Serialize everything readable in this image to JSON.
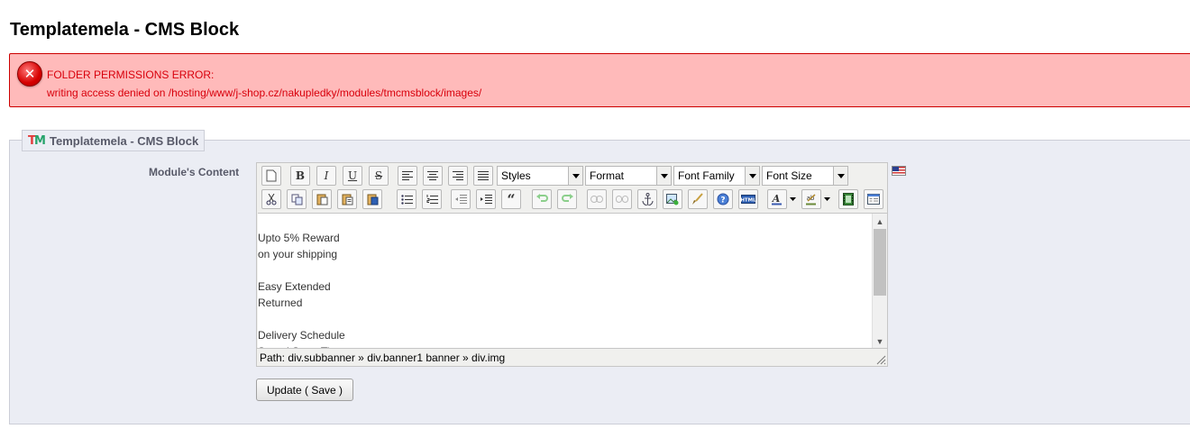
{
  "page": {
    "title": "Templatemela - CMS Block"
  },
  "error": {
    "title": "FOLDER PERMISSIONS ERROR:",
    "message": "writing access denied on /hosting/www/j-shop.cz/nakupledky/modules/tmcmsblock/images/",
    "icon": "error-x-icon",
    "color": "#d8000c",
    "background": "#ffbaba"
  },
  "panel": {
    "legend": "Templatemela - CMS Block",
    "field_label": "Module's Content"
  },
  "editor": {
    "dropdowns": {
      "styles": "Styles",
      "format": "Format",
      "font_family": "Font Family",
      "font_size": "Font Size"
    },
    "content_lines": [
      "Upto 5% Reward",
      "on your shipping",
      "",
      "Easy Extended",
      "Returned",
      "",
      "Delivery Schedule",
      "Spend Store Time"
    ],
    "path": "Path: div.subbanner » div.banner1 banner » div.img"
  },
  "actions": {
    "save_label": "Update ( Save )"
  }
}
